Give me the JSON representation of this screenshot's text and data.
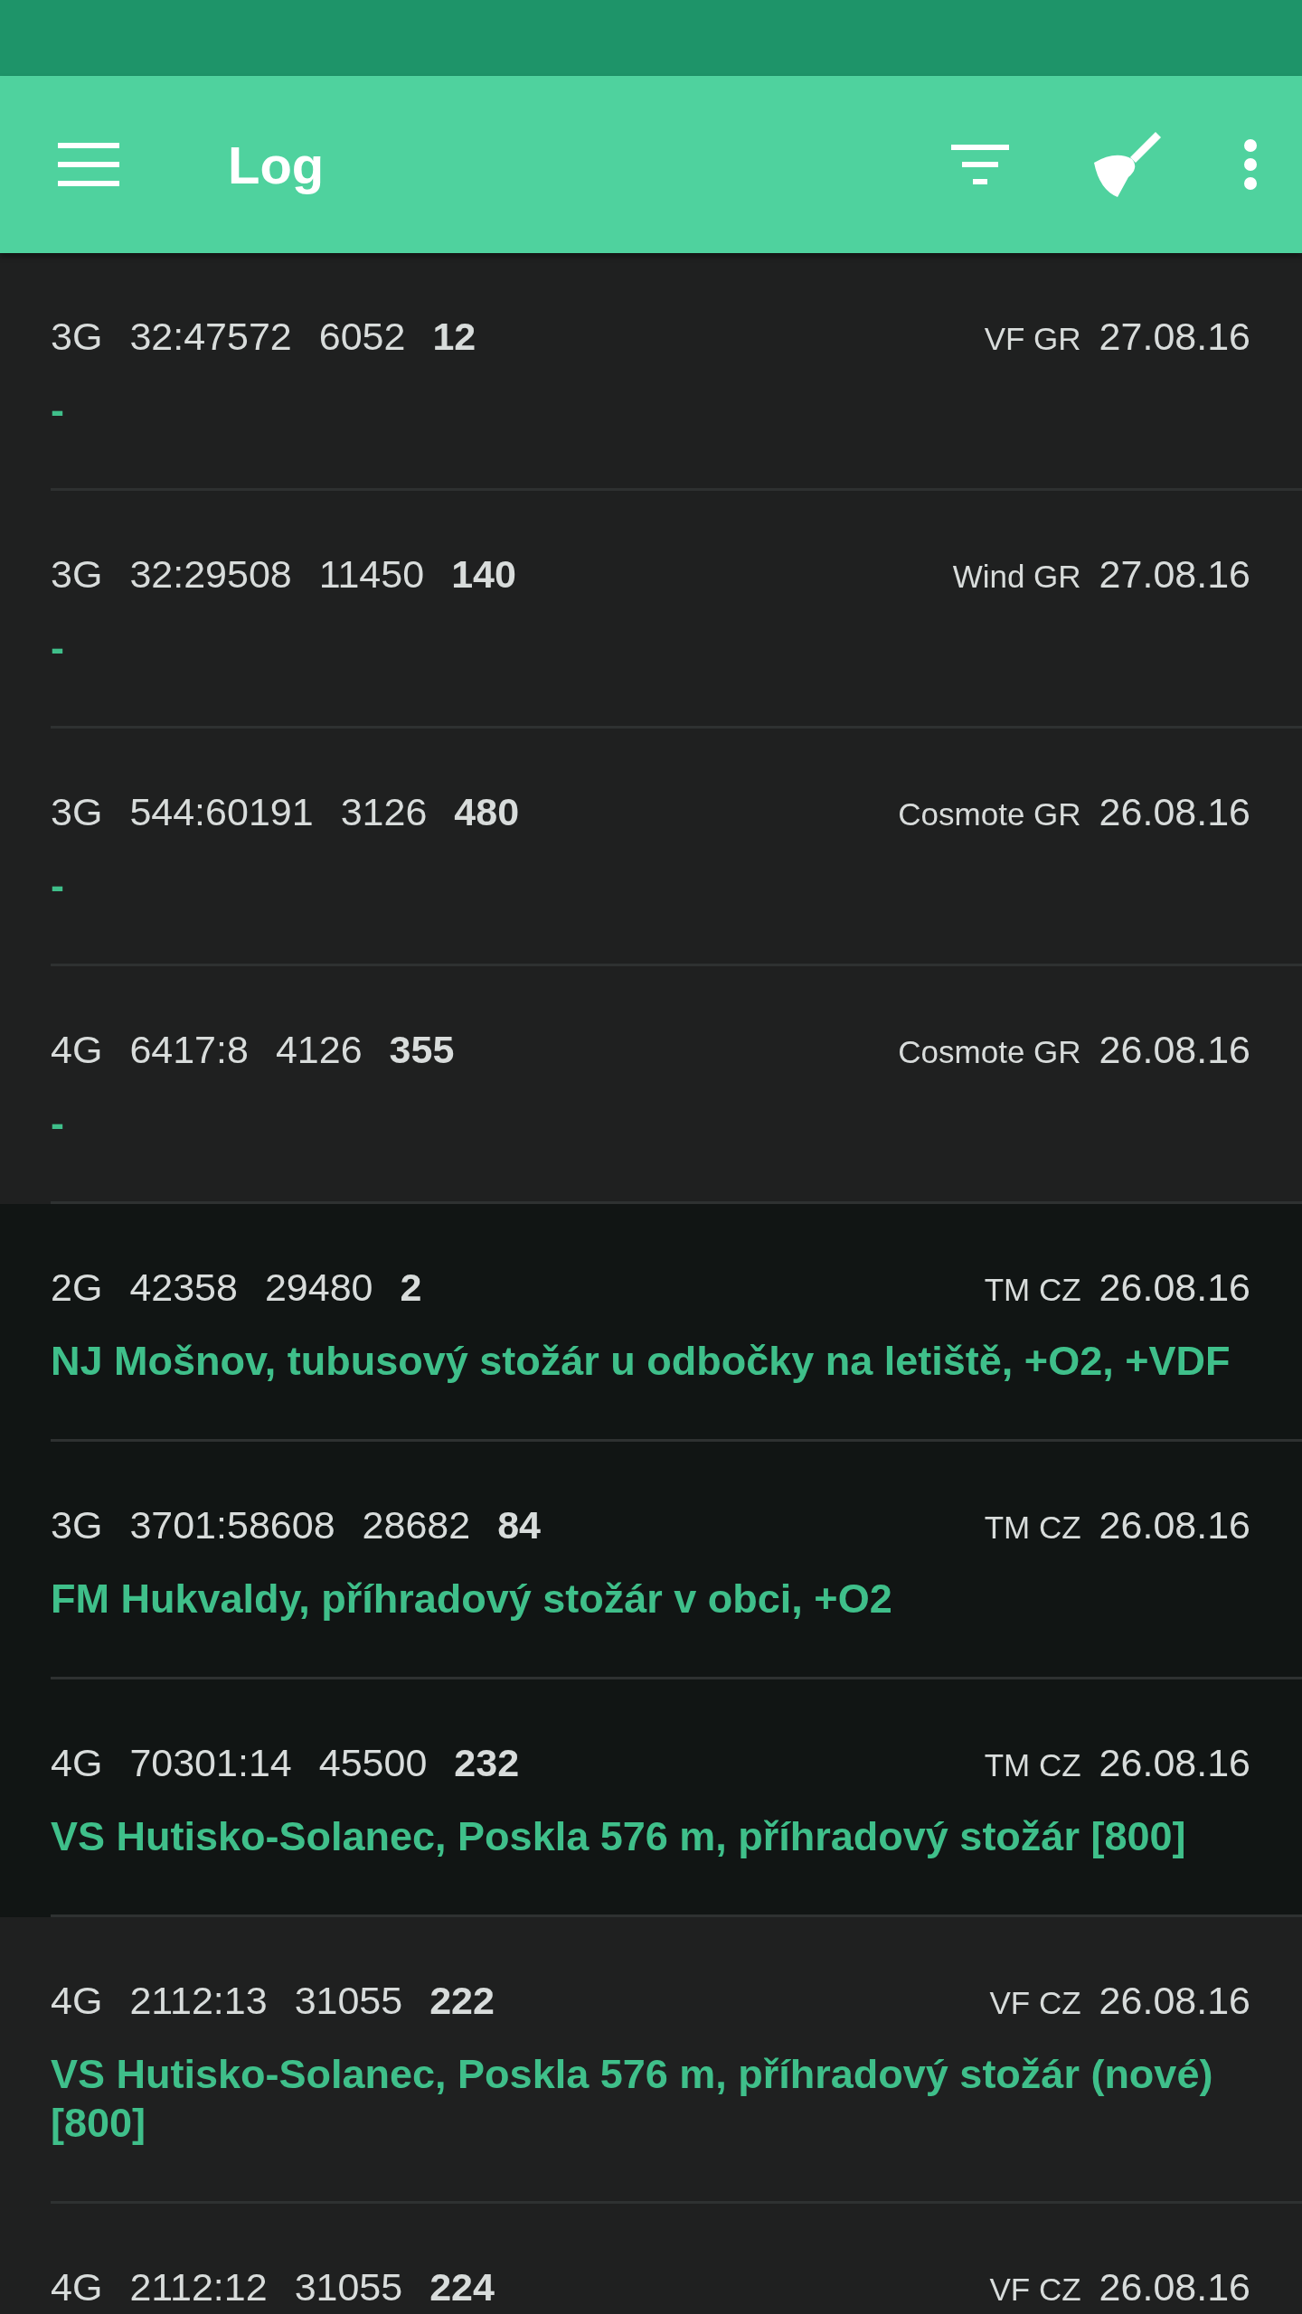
{
  "toolbar": {
    "title": "Log"
  },
  "entries": [
    {
      "tech": "3G",
      "cell": "32:47572",
      "area": "6052",
      "signal": "12",
      "operator": "VF GR",
      "date": "27.08.16",
      "site": "-",
      "highlighted": false
    },
    {
      "tech": "3G",
      "cell": "32:29508",
      "area": "11450",
      "signal": "140",
      "operator": "Wind GR",
      "date": "27.08.16",
      "site": "-",
      "highlighted": false
    },
    {
      "tech": "3G",
      "cell": "544:60191",
      "area": "3126",
      "signal": "480",
      "operator": "Cosmote GR",
      "date": "26.08.16",
      "site": "-",
      "highlighted": false
    },
    {
      "tech": "4G",
      "cell": "6417:8",
      "area": "4126",
      "signal": "355",
      "operator": "Cosmote GR",
      "date": "26.08.16",
      "site": "-",
      "highlighted": false
    },
    {
      "tech": "2G",
      "cell": "42358",
      "area": "29480",
      "signal": "2",
      "operator": "TM CZ",
      "date": "26.08.16",
      "site": "NJ Mošnov, tubusový stožár u odbočky na letiště, +O2, +VDF",
      "highlighted": true
    },
    {
      "tech": "3G",
      "cell": "3701:58608",
      "area": "28682",
      "signal": "84",
      "operator": "TM CZ",
      "date": "26.08.16",
      "site": "FM Hukvaldy, příhradový stožár v obci, +O2",
      "highlighted": true
    },
    {
      "tech": "4G",
      "cell": "70301:14",
      "area": "45500",
      "signal": "232",
      "operator": "TM CZ",
      "date": "26.08.16",
      "site": "VS Hutisko-Solanec, Poskla 576 m, příhradový stožár [800]",
      "highlighted": true
    },
    {
      "tech": "4G",
      "cell": "2112:13",
      "area": "31055",
      "signal": "222",
      "operator": "VF CZ",
      "date": "26.08.16",
      "site": "VS Hutisko-Solanec, Poskla 576 m, příhradový stožár (nové) [800]",
      "highlighted": false
    },
    {
      "tech": "4G",
      "cell": "2112:12",
      "area": "31055",
      "signal": "224",
      "operator": "VF CZ",
      "date": "26.08.16",
      "highlighted": false
    }
  ]
}
